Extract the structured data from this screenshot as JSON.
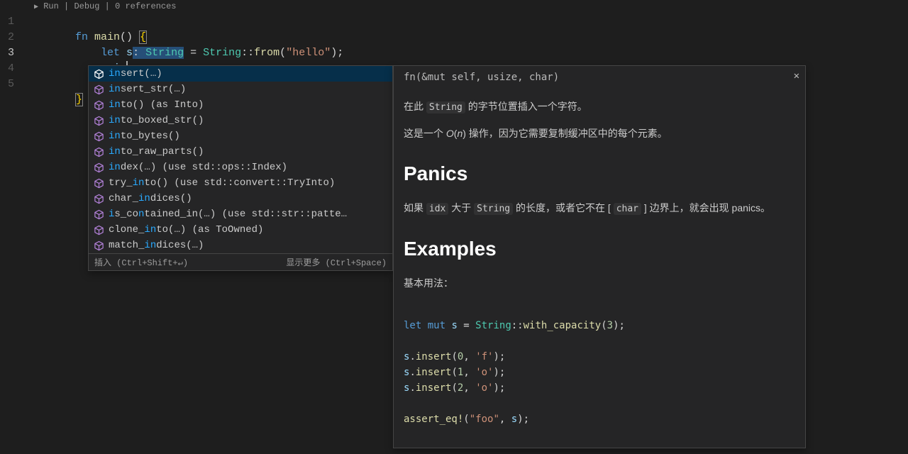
{
  "codelens": {
    "run": "Run",
    "debug": "Debug",
    "refs": "0 references"
  },
  "code": {
    "l1": {
      "kw": "fn ",
      "fn": "main",
      "paren": "()",
      "sp": " ",
      "brace": "{"
    },
    "l2": {
      "indent": "    ",
      "let": "let ",
      "var": "s",
      "colon": ":",
      "sp": " ",
      "ty": "String",
      "eq": " = ",
      "ty2": "String",
      "sep": "::",
      "from": "from",
      "open": "(",
      "str": "\"hello\"",
      "close": ")",
      "semi": ";"
    },
    "l3": {
      "indent": "    ",
      "var": "s",
      "dot": ".",
      "typed": "i",
      "typed2": "n"
    },
    "l5": {
      "brace": "}"
    }
  },
  "suggest": {
    "items": [
      {
        "pre": "in",
        "rest": "sert(…)",
        "sel": true
      },
      {
        "pre": "in",
        "rest": "sert_str(…)"
      },
      {
        "pre": "in",
        "rest": "to() (as Into)"
      },
      {
        "pre": "in",
        "rest": "to_boxed_str()"
      },
      {
        "pre": "in",
        "rest": "to_bytes()"
      },
      {
        "pre": "in",
        "rest": "to_raw_parts()"
      },
      {
        "pre": "in",
        "rest": "dex(…) (use std::ops::Index)"
      },
      {
        "pre": "",
        "label": "try_",
        "mid": "in",
        "rest": "to() (use std::convert::TryInto)"
      },
      {
        "pre": "",
        "label": "char_",
        "mid": "in",
        "rest": "dices()"
      },
      {
        "pre": "",
        "label": "is_co",
        "mid": "n",
        "rest": "tained_in(…) (use std::str::patte…",
        "special": true,
        "pre_match": "i"
      },
      {
        "pre": "",
        "label": "clone_",
        "mid": "in",
        "rest": "to(…) (as ToOwned)"
      },
      {
        "pre": "",
        "label": "match_",
        "mid": "in",
        "rest": "dices(…)"
      }
    ],
    "footer": {
      "left": "插入 (Ctrl+Shift+↵)",
      "right": "显示更多 (Ctrl+Space)"
    }
  },
  "doc": {
    "signature": "fn(&mut self, usize, char)",
    "p1_a": "在此 ",
    "p1_code": "String",
    "p1_b": " 的字节位置插入一个字符。",
    "p2_a": "这是一个 ",
    "p2_i": "O",
    "p2_open": "(",
    "p2_n": "n",
    "p2_close": ")",
    "p2_b": " 操作，因为它需要复制缓冲区中的每个元素。",
    "h1": "Panics",
    "p3_a": "如果 ",
    "p3_c1": "idx",
    "p3_b": " 大于 ",
    "p3_c2": "String",
    "p3_c": " 的长度，或者它不在 [ ",
    "p3_c3": "char",
    "p3_d": " ] 边界上，就会出现 panics。",
    "h2": "Examples",
    "p4": "基本用法：",
    "ex": {
      "l1": {
        "let": "let ",
        "mut": "mut ",
        "s": "s",
        "eq": " = ",
        "ty": "String",
        "sep": "::",
        "fn": "with_capacity",
        "open": "(",
        "n": "3",
        "close": ")",
        "semi": ";"
      },
      "l2": {
        "v": "s",
        "dot": ".",
        "fn": "insert",
        "open": "(",
        "n": "0",
        "comma": ", ",
        "ch": "'f'",
        "close": ")",
        "semi": ";"
      },
      "l3": {
        "v": "s",
        "dot": ".",
        "fn": "insert",
        "open": "(",
        "n": "1",
        "comma": ", ",
        "ch": "'o'",
        "close": ")",
        "semi": ";"
      },
      "l4": {
        "v": "s",
        "dot": ".",
        "fn": "insert",
        "open": "(",
        "n": "2",
        "comma": ", ",
        "ch": "'o'",
        "close": ")",
        "semi": ";"
      },
      "l5": {
        "mac": "assert_eq!",
        "open": "(",
        "str": "\"foo\"",
        "comma": ", ",
        "v": "s",
        "close": ")",
        "semi": ";"
      }
    }
  },
  "lines": [
    "1",
    "2",
    "3",
    "4",
    "5"
  ]
}
